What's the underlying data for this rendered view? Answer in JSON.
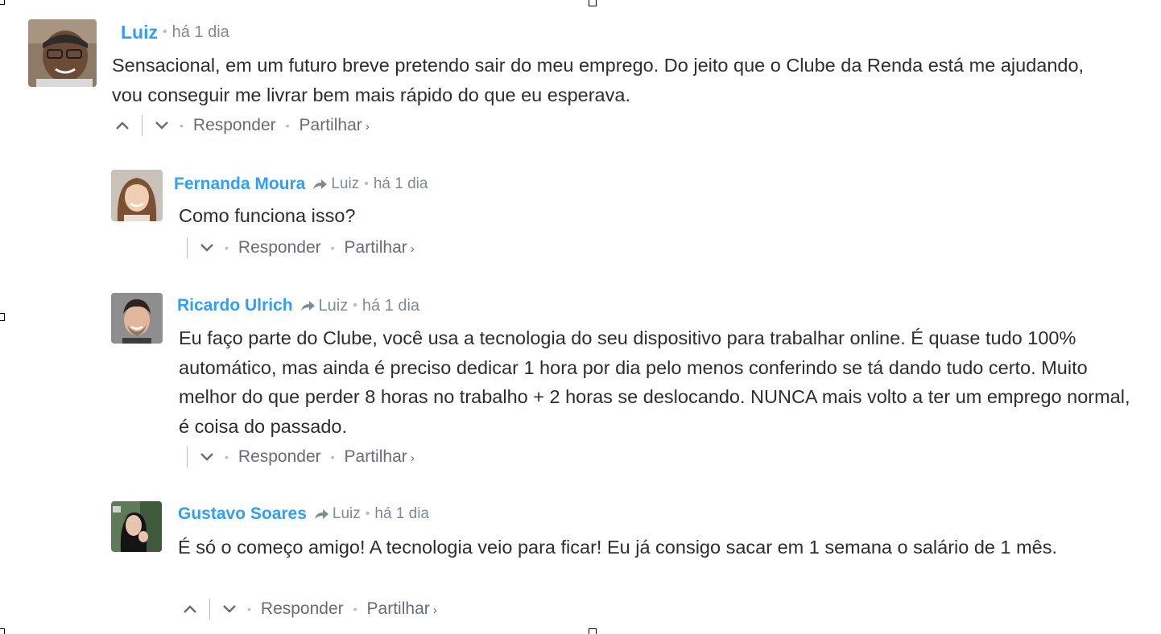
{
  "comments": [
    {
      "author": "Luiz",
      "time": "há 1 dia",
      "reply_to": "",
      "text": "Sensacional, em um futuro breve pretendo sair do meu emprego. Do jeito que o Clube da Renda está me ajudando, vou conseguir me livrar bem mais rápido do que eu esperava.",
      "reply_label": "Responder",
      "share_label": "Partilhar"
    },
    {
      "author": "Fernanda Moura",
      "time": "há 1 dia",
      "reply_to": "Luiz",
      "text": "Como funciona isso?",
      "reply_label": "Responder",
      "share_label": "Partilhar"
    },
    {
      "author": "Ricardo Ulrich",
      "time": "há 1 dia",
      "reply_to": "Luiz",
      "text": "Eu faço parte do Clube, você usa a tecnologia do seu dispositivo para trabalhar online. É quase tudo 100% automático, mas ainda é preciso dedicar 1 hora por dia pelo menos conferindo se tá dando tudo certo. Muito melhor do que perder 8 horas no trabalho + 2 horas se deslocando. NUNCA mais volto a ter um emprego normal, é coisa do passado.",
      "reply_label": "Responder",
      "share_label": "Partilhar"
    },
    {
      "author": "Gustavo Soares",
      "time": "há 1 dia",
      "reply_to": "Luiz",
      "text": "É só o começo amigo! A tecnologia veio para ficar! Eu já consigo sacar em 1 semana o salário de 1 mês.",
      "reply_label": "Responder",
      "share_label": "Partilhar"
    }
  ],
  "icons": {
    "upvote": "chevron-up-icon",
    "downvote": "chevron-down-icon",
    "reply_arrow": "reply-arrow-icon",
    "share_chevron": "chevron-right-icon"
  },
  "colors": {
    "author": "#2e9fff",
    "text": "#2a2e2e",
    "meta": "#7f8a91",
    "actions": "#656c7a"
  }
}
